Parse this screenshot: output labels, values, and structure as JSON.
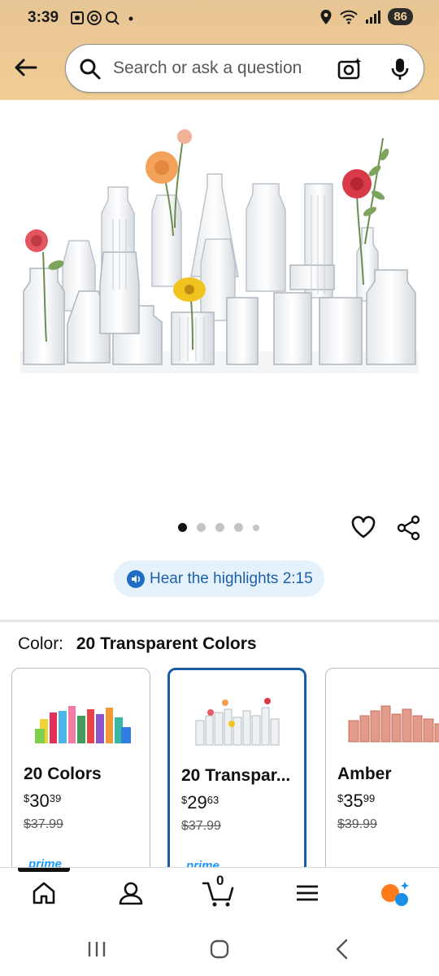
{
  "status": {
    "time": "3:39",
    "battery": "86"
  },
  "search": {
    "placeholder": "Search or ask a question"
  },
  "gallery": {
    "image_count": 5,
    "active_index": 0
  },
  "highlights": {
    "label": "Hear the highlights 2:15"
  },
  "color": {
    "label": "Color:",
    "selected": "20 Transparent Colors"
  },
  "swatches": [
    {
      "name": "20 Colors",
      "price_dollars": "30",
      "price_cents": "39",
      "list_price": "$37.99",
      "prime": "prime"
    },
    {
      "name": "20 Transpar...",
      "price_dollars": "29",
      "price_cents": "63",
      "list_price": "$37.99",
      "prime": "prime"
    },
    {
      "name": "Amber",
      "price_dollars": "35",
      "price_cents": "99",
      "list_price": "$39.99",
      "prime": ""
    }
  ],
  "nav": {
    "cart_count": "0"
  },
  "currency_symbol": "$"
}
